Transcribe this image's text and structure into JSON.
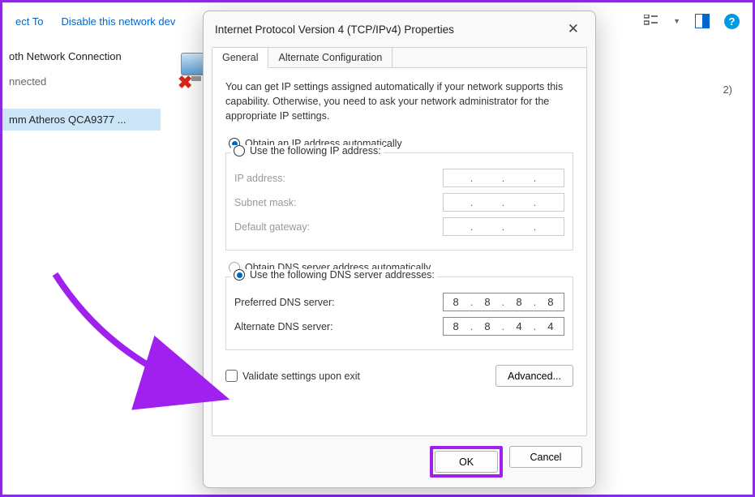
{
  "background": {
    "connect_to": "ect To",
    "disable_device": "Disable this network dev",
    "connection_name": "oth Network Connection",
    "connection_status": "nnected",
    "adapter_name": "mm Atheros QCA9377 ...",
    "count_suffix": "2)"
  },
  "help_icon_text": "?",
  "dialog": {
    "title": "Internet Protocol Version 4 (TCP/IPv4) Properties",
    "tabs": [
      {
        "label": "General",
        "active": true
      },
      {
        "label": "Alternate Configuration",
        "active": false
      }
    ],
    "intro": "You can get IP settings assigned automatically if your network supports this capability. Otherwise, you need to ask your network administrator for the appropriate IP settings.",
    "ip_section": {
      "auto_label": "Obtain an IP address automatically",
      "manual_label": "Use the following IP address:",
      "selected": "auto",
      "fields": {
        "ip_address": {
          "label": "IP address:",
          "value": [
            "",
            "",
            "",
            ""
          ]
        },
        "subnet_mask": {
          "label": "Subnet mask:",
          "value": [
            "",
            "",
            "",
            ""
          ]
        },
        "default_gateway": {
          "label": "Default gateway:",
          "value": [
            "",
            "",
            "",
            ""
          ]
        }
      }
    },
    "dns_section": {
      "auto_label": "Obtain DNS server address automatically",
      "manual_label": "Use the following DNS server addresses:",
      "selected": "manual",
      "fields": {
        "preferred": {
          "label": "Preferred DNS server:",
          "value": [
            "8",
            "8",
            "8",
            "8"
          ]
        },
        "alternate": {
          "label": "Alternate DNS server:",
          "value": [
            "8",
            "8",
            "4",
            "4"
          ]
        }
      }
    },
    "validate_checkbox": {
      "label": "Validate settings upon exit",
      "checked": false
    },
    "advanced_button": "Advanced...",
    "ok_button": "OK",
    "cancel_button": "Cancel"
  }
}
